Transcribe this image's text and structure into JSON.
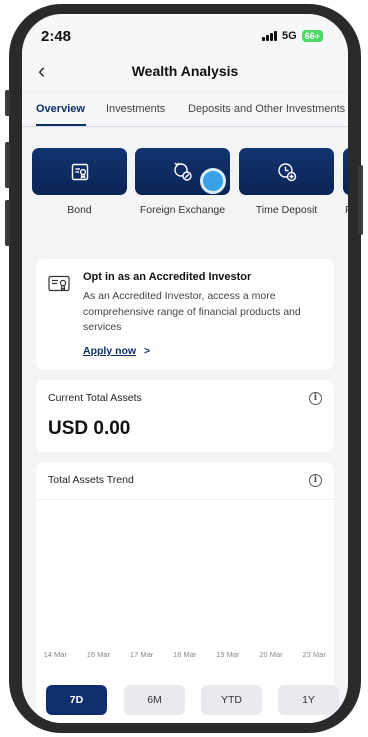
{
  "status": {
    "time": "2:48",
    "network": "5G",
    "battery": "66+"
  },
  "nav": {
    "back": "‹",
    "title": "Wealth Analysis"
  },
  "tabs": [
    {
      "label": "Overview",
      "active": true
    },
    {
      "label": "Investments"
    },
    {
      "label": "Deposits and Other Investments"
    }
  ],
  "shortcuts": [
    {
      "label": "Bond",
      "icon": "bond-icon"
    },
    {
      "label": "Foreign Exchange",
      "icon": "foreign-exchange-icon"
    },
    {
      "label": "Time Deposit",
      "icon": "time-deposit-icon"
    },
    {
      "label": "Pr",
      "icon": "product-icon"
    }
  ],
  "accredited": {
    "title": "Opt in as an Accredited Investor",
    "description": "As an Accredited Investor, access a more comprehensive range of financial products and services",
    "link": "Apply now",
    "link_arrow": ">"
  },
  "assets": {
    "label": "Current Total Assets",
    "value": "USD 0.00"
  },
  "trend": {
    "title": "Total Assets Trend",
    "x_labels": [
      "14 Mar",
      "16 Mar",
      "17 Mar",
      "18 Mar",
      "19 Mar",
      "20 Mar",
      "23 Mar"
    ]
  },
  "periods": [
    {
      "label": "7D",
      "active": true
    },
    {
      "label": "6M"
    },
    {
      "label": "YTD"
    },
    {
      "label": "1Y"
    }
  ],
  "colors": {
    "navy": "#0e2f6b",
    "tile": "#123470",
    "touch": "#3aa0e6"
  }
}
